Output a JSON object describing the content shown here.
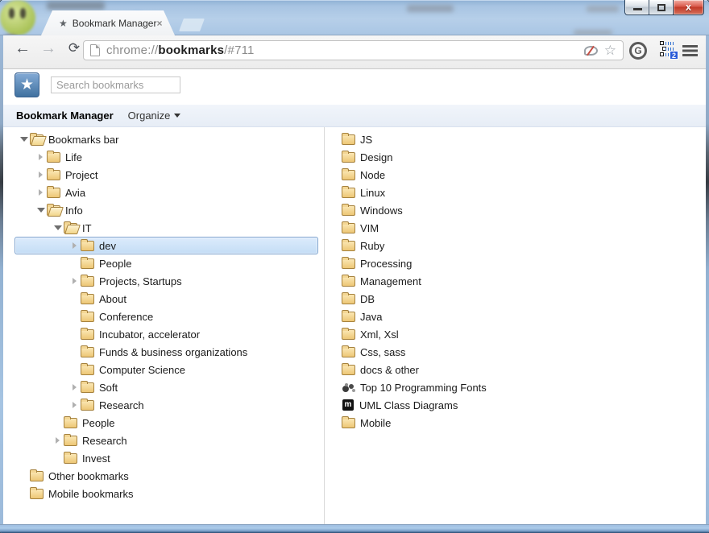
{
  "window": {
    "tab_title": "Bookmark Manager",
    "tab_close_glyph": "×",
    "controls": {
      "close_glyph": "x"
    }
  },
  "toolbar": {
    "url": {
      "scheme": "chrome://",
      "domain": "bookmarks",
      "suffix": "/#711"
    }
  },
  "search": {
    "placeholder": "Search bookmarks"
  },
  "header": {
    "title": "Bookmark Manager",
    "organize_label": "Organize"
  },
  "logo": {
    "star_glyph": "★"
  },
  "tree": {
    "items": [
      {
        "label": "Bookmarks bar",
        "level": 0,
        "arrow": "expanded",
        "folder": "open",
        "selected": false
      },
      {
        "label": "Life",
        "level": 1,
        "arrow": "collapsed",
        "folder": "closed",
        "selected": false
      },
      {
        "label": "Project",
        "level": 1,
        "arrow": "collapsed",
        "folder": "closed",
        "selected": false
      },
      {
        "label": "Avia",
        "level": 1,
        "arrow": "collapsed",
        "folder": "closed",
        "selected": false
      },
      {
        "label": "Info",
        "level": 1,
        "arrow": "expanded",
        "folder": "open",
        "selected": false
      },
      {
        "label": "IT",
        "level": 2,
        "arrow": "expanded",
        "folder": "open",
        "selected": false
      },
      {
        "label": "dev",
        "level": 3,
        "arrow": "collapsed",
        "folder": "closed",
        "selected": true
      },
      {
        "label": "People",
        "level": 3,
        "arrow": "none",
        "folder": "closed",
        "selected": false
      },
      {
        "label": "Projects, Startups",
        "level": 3,
        "arrow": "collapsed",
        "folder": "closed",
        "selected": false
      },
      {
        "label": "About",
        "level": 3,
        "arrow": "none",
        "folder": "closed",
        "selected": false
      },
      {
        "label": "Conference",
        "level": 3,
        "arrow": "none",
        "folder": "closed",
        "selected": false
      },
      {
        "label": "Incubator, accelerator",
        "level": 3,
        "arrow": "none",
        "folder": "closed",
        "selected": false
      },
      {
        "label": "Funds & business organizations",
        "level": 3,
        "arrow": "none",
        "folder": "closed",
        "selected": false
      },
      {
        "label": "Computer Science",
        "level": 3,
        "arrow": "none",
        "folder": "closed",
        "selected": false
      },
      {
        "label": "Soft",
        "level": 3,
        "arrow": "collapsed",
        "folder": "closed",
        "selected": false
      },
      {
        "label": "Research",
        "level": 3,
        "arrow": "collapsed",
        "folder": "closed",
        "selected": false
      },
      {
        "label": "People",
        "level": 2,
        "arrow": "none",
        "folder": "closed",
        "selected": false
      },
      {
        "label": "Research",
        "level": 2,
        "arrow": "collapsed",
        "folder": "closed",
        "selected": false
      },
      {
        "label": "Invest",
        "level": 2,
        "arrow": "none",
        "folder": "closed",
        "selected": false
      },
      {
        "label": "Other bookmarks",
        "level": 0,
        "arrow": "none",
        "folder": "closed",
        "selected": false
      },
      {
        "label": "Mobile bookmarks",
        "level": 0,
        "arrow": "none",
        "folder": "closed",
        "selected": false
      }
    ]
  },
  "list": {
    "items": [
      {
        "label": "JS",
        "icon": "folder"
      },
      {
        "label": "Design",
        "icon": "folder"
      },
      {
        "label": "Node",
        "icon": "folder"
      },
      {
        "label": "Linux",
        "icon": "folder"
      },
      {
        "label": "Windows",
        "icon": "folder"
      },
      {
        "label": "VIM",
        "icon": "folder"
      },
      {
        "label": "Ruby",
        "icon": "folder"
      },
      {
        "label": "Processing",
        "icon": "folder"
      },
      {
        "label": "Management",
        "icon": "folder"
      },
      {
        "label": "DB",
        "icon": "folder"
      },
      {
        "label": "Java",
        "icon": "folder"
      },
      {
        "label": "Xml, Xsl",
        "icon": "folder"
      },
      {
        "label": "Css, sass",
        "icon": "folder"
      },
      {
        "label": "docs & other",
        "icon": "folder"
      },
      {
        "label": "Top 10 Programming Fonts",
        "icon": "fly-favicon"
      },
      {
        "label": "UML Class Diagrams",
        "icon": "uml-favicon",
        "favicon_letter": "m"
      },
      {
        "label": "Mobile",
        "icon": "folder"
      }
    ]
  },
  "colors": {
    "selection_border": "#7da2ce",
    "selection_fill_top": "#dcebfc",
    "selection_fill_bottom": "#c4ddf5",
    "folder_fill": "#edc675",
    "folder_border": "#a5813d",
    "glass_blue": "#aac6e4",
    "close_button_red": "#c23a28",
    "extension_badge_blue": "#2a5bd7"
  }
}
